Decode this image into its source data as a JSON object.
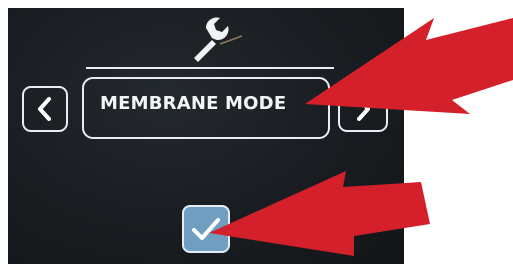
{
  "screen": {
    "mode_label": "MEMBRANE MODE"
  },
  "icons": {
    "header": "wrench-icon",
    "prev": "chevron-left-icon",
    "next": "chevron-right-icon",
    "confirm": "checkmark-icon"
  },
  "colors": {
    "screen_background": "#1b1f23",
    "outline": "#e7edf2",
    "confirm_button": "#6f9ec1",
    "annotation_arrow": "#d4202a"
  }
}
